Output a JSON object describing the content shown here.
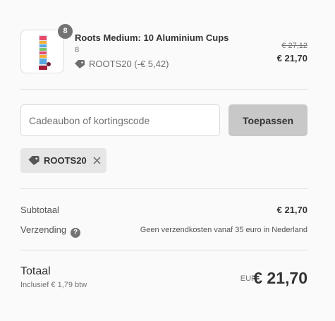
{
  "product": {
    "quantity": "8",
    "title": "Roots Medium: 10 Aluminium Cups",
    "variant": "8",
    "discount": "ROOTS20 (-€ 5,42)",
    "original_price": "€ 27,12",
    "price": "€ 21,70",
    "icons": {
      "tag": "tag-icon"
    }
  },
  "coupon": {
    "placeholder": "Cadeaubon of kortingscode",
    "apply_label": "Toepassen",
    "applied_code": "ROOTS20",
    "remove_icon": "close-icon"
  },
  "summary": {
    "subtotal_label": "Subtotaal",
    "subtotal_value": "€ 21,70",
    "shipping_label": "Verzending",
    "shipping_help_icon": "question-icon",
    "shipping_value": "Geen verzendkosten vanaf 35 euro in Nederland",
    "total_label": "Totaal",
    "tax_note": "Inclusief € 1,79 btw",
    "currency": "EUR",
    "total_value": "€ 21,70"
  },
  "colors": {
    "background": "#fafafa",
    "badge": "#737373",
    "button": "#c8c8c8",
    "chip": "#e6e6e6"
  }
}
